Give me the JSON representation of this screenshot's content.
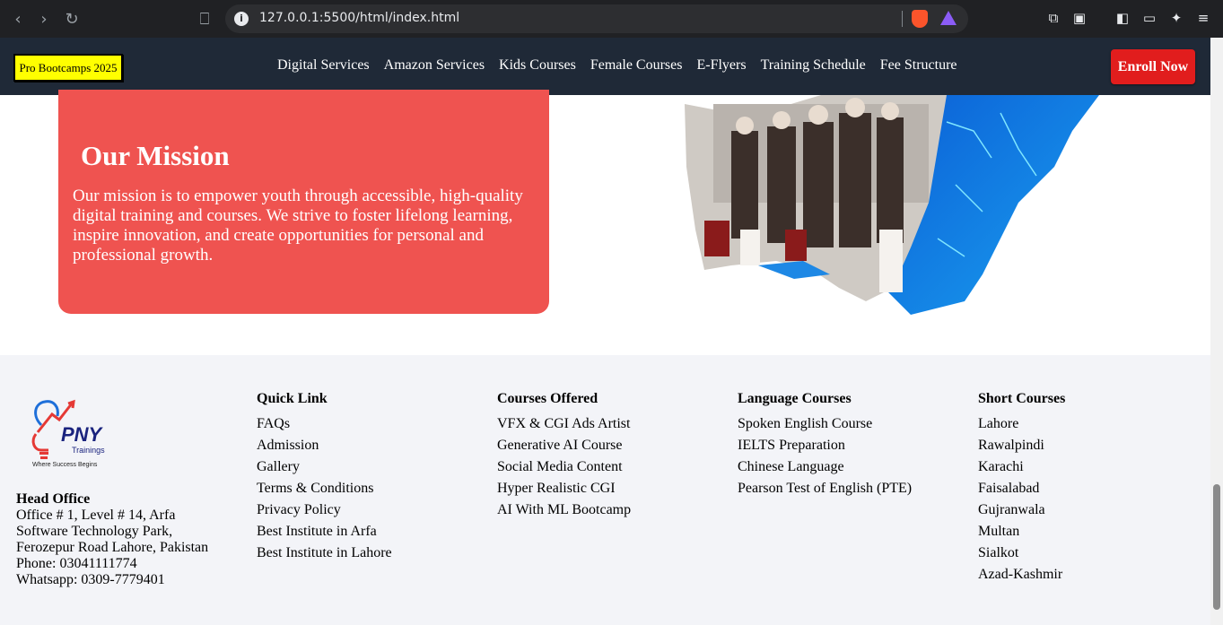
{
  "browser": {
    "url": "127.0.0.1:5500/html/index.html"
  },
  "header": {
    "badge": "Pro Bootcamps 2025",
    "menu": [
      "Digital Services",
      "Amazon Services",
      "Kids Courses",
      "Female Courses",
      "E-Flyers",
      "Training Schedule",
      "Fee Structure"
    ],
    "enroll": "Enroll Now"
  },
  "mission": {
    "title": "Our Mission",
    "text": "Our mission is to empower youth through accessible, high-quality digital training and courses. We strive to foster lifelong learning, inspire innovation, and create opportunities for personal and professional growth."
  },
  "footer": {
    "logo_text": "PNY",
    "logo_sub": "Trainings",
    "logo_tagline": "Where Success Begins",
    "head_office": {
      "title": "Head Office",
      "lines": [
        "Office # 1, Level # 14, Arfa",
        "Software Technology Park,",
        "Ferozepur Road Lahore, Pakistan",
        "Phone: 03041111774",
        "Whatsapp: 0309-7779401"
      ]
    },
    "columns": [
      {
        "title": "Quick Link",
        "items": [
          "FAQs",
          "Admission",
          "Gallery",
          "Terms & Conditions",
          "Privacy Policy",
          "Best Institute in Arfa",
          "Best Institute in Lahore"
        ]
      },
      {
        "title": "Courses Offered",
        "items": [
          "VFX & CGI Ads Artist",
          "Generative AI Course",
          "Social Media Content",
          "Hyper Realistic CGI",
          "AI With ML Bootcamp"
        ]
      },
      {
        "title": "Language Courses",
        "items": [
          "Spoken English Course",
          "IELTS Preparation",
          "Chinese Language",
          "Pearson Test of English (PTE)"
        ]
      },
      {
        "title": "Short Courses",
        "items": [
          "Lahore",
          "Rawalpindi",
          "Karachi",
          "Faisalabad",
          "Gujranwala",
          "Multan",
          "Sialkot",
          "Azad-Kashmir"
        ]
      }
    ]
  },
  "colors": {
    "header_bg": "#1f2937",
    "badge_bg": "#ffff00",
    "enroll_bg": "#e11d1d",
    "mission_bg": "#ef5350",
    "footer_bg": "#f3f4f8"
  }
}
